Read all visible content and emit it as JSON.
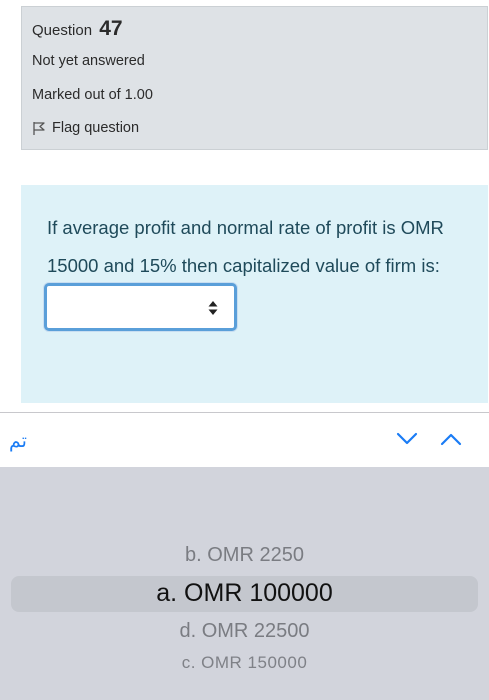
{
  "question_info": {
    "question_label": "Question",
    "question_number": "47",
    "status": "Not yet answered",
    "marks": "Marked out of 1.00",
    "flag_label": "Flag question"
  },
  "question": {
    "text": "If average profit and normal rate of profit is OMR 15000 and 15% then capitalized value of firm is:",
    "selected_value": ""
  },
  "toolbar": {
    "done_label": "تم",
    "accent_color": "#1a7cf5"
  },
  "picker": {
    "options": [
      {
        "label": "b. OMR 2250"
      },
      {
        "label": "a. OMR 100000",
        "selected": true
      },
      {
        "label": "d. OMR 22500"
      },
      {
        "label": "c. OMR 150000"
      }
    ]
  },
  "colors": {
    "info_bg": "#dee2e6",
    "question_bg": "#def2f8",
    "picker_bg": "#d2d4dc"
  }
}
